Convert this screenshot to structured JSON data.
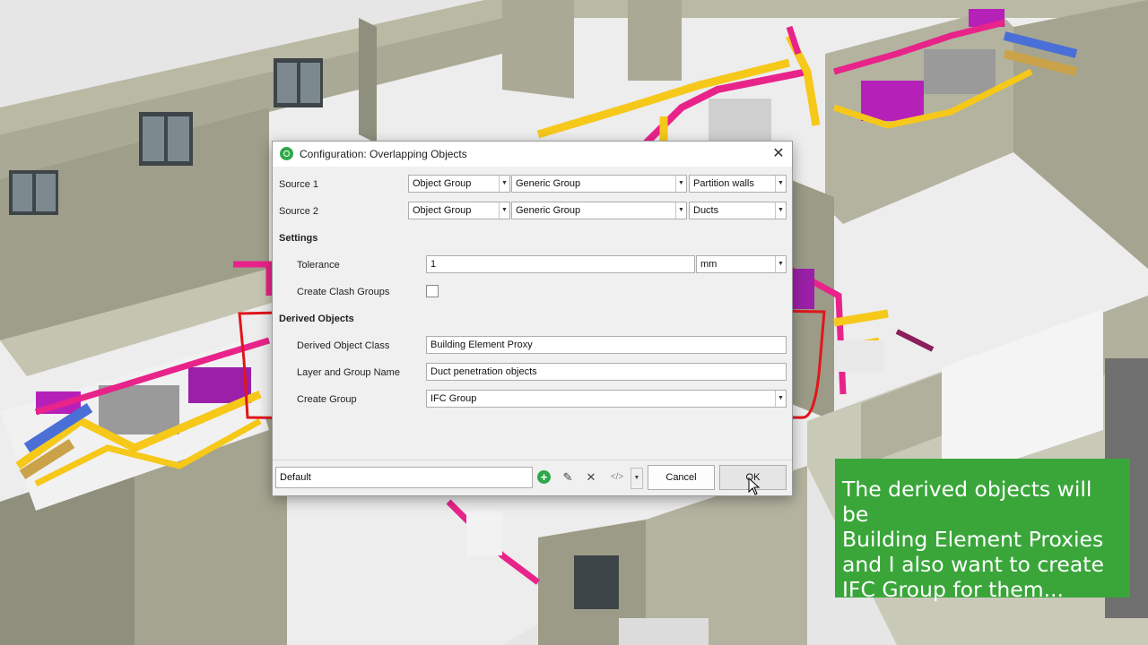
{
  "dialog": {
    "title": "Configuration: Overlapping Objects",
    "close_label": "✕",
    "source1": {
      "label": "Source 1",
      "type": "Object Group",
      "group": "Generic Group",
      "value": "Partition walls"
    },
    "source2": {
      "label": "Source 2",
      "type": "Object Group",
      "group": "Generic Group",
      "value": "Ducts"
    },
    "settings": {
      "heading": "Settings",
      "tolerance_label": "Tolerance",
      "tolerance_value": "1",
      "tolerance_unit": "mm",
      "clash_groups_label": "Create Clash Groups",
      "clash_groups_checked": false
    },
    "derived": {
      "heading": "Derived Objects",
      "class_label": "Derived Object Class",
      "class_value": "Building Element Proxy",
      "layer_label": "Layer and Group Name",
      "layer_value": "Duct penetration objects",
      "group_label": "Create Group",
      "group_value": "IFC Group"
    },
    "footer": {
      "preset_value": "Default",
      "cancel_label": "Cancel",
      "ok_label": "OK",
      "icons": [
        "add-icon",
        "edit-icon",
        "delete-icon",
        "code-icon",
        "chevron-down-icon"
      ]
    }
  },
  "callout": {
    "lines": [
      "The derived objects will be",
      "Building Element Proxies",
      "and I also want to create",
      "IFC Group for them..."
    ],
    "color": "#3aa63a"
  },
  "colors": {
    "highlight": "#e0161b",
    "pipe_yellow": "#f6c81a",
    "pipe_magenta": "#e8238a",
    "duct_blue": "#4a6fd6",
    "wall": "#c9c9b8"
  }
}
